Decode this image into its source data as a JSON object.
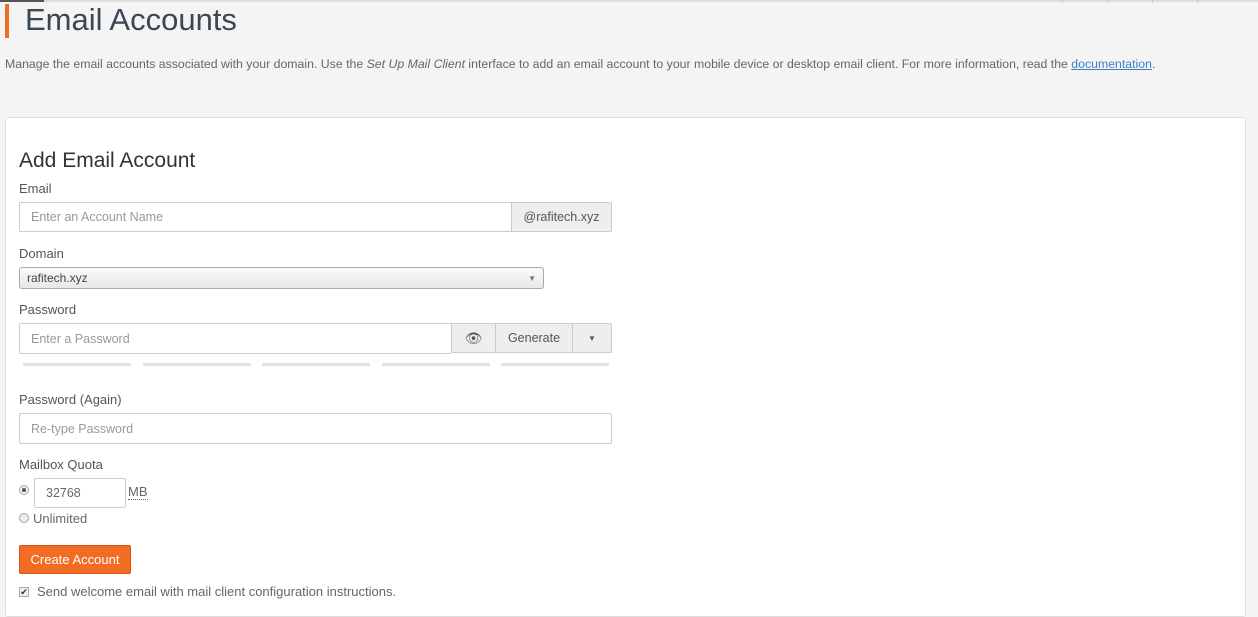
{
  "header": {
    "title": "Email Accounts",
    "description_pre": "Manage the email accounts associated with your domain. Use the ",
    "description_em": "Set Up Mail Client",
    "description_mid": " interface to add an email account to your mobile device or desktop email client. For more information, read the ",
    "description_link": "documentation",
    "description_post": "."
  },
  "form": {
    "title": "Add Email Account",
    "email_label": "Email",
    "email_placeholder": "Enter an Account Name",
    "email_suffix": "@rafitech.xyz",
    "domain_label": "Domain",
    "domain_value": "rafitech.xyz",
    "password_label": "Password",
    "password_placeholder": "Enter a Password",
    "generate_label": "Generate",
    "password_again_label": "Password (Again)",
    "password_again_placeholder": "Re-type Password",
    "quota_label": "Mailbox Quota",
    "quota_value": "32768",
    "quota_unit": "MB",
    "unlimited_label": "Unlimited",
    "create_label": "Create Account",
    "welcome_label": "Send welcome email with mail client configuration instructions."
  },
  "colors": {
    "accent": "#f26c24",
    "link": "#3b7fc4"
  }
}
